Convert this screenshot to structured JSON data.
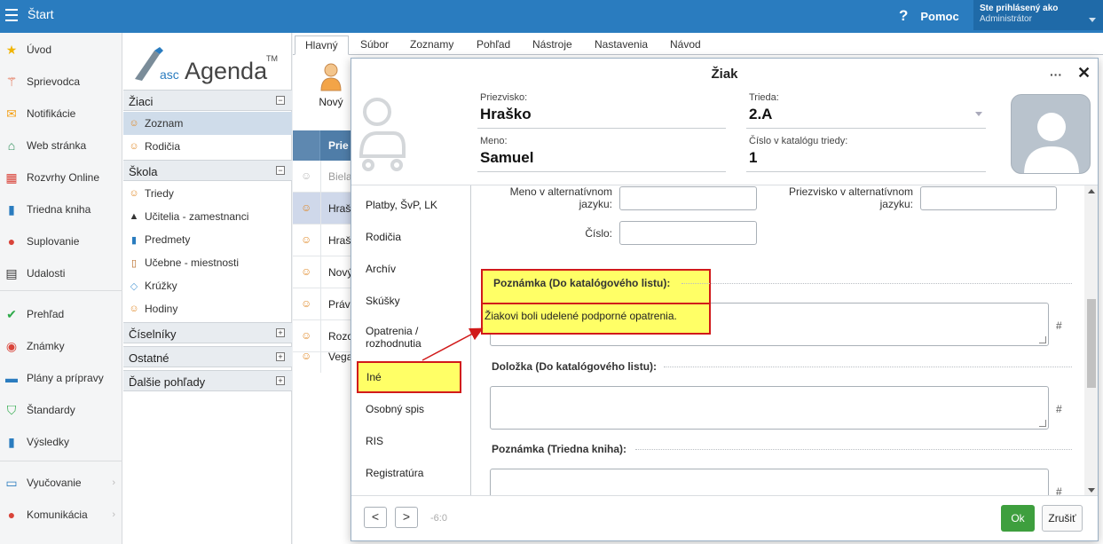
{
  "topbar": {
    "title": "Štart",
    "help": "Pomoc",
    "user_label": "Ste prihlásený ako",
    "user_name": "Administrátor"
  },
  "left_nav": [
    {
      "label": "Úvod",
      "icon": "star-icon",
      "color": "#f0b400"
    },
    {
      "label": "Sprievodca",
      "icon": "wand-icon",
      "color": "#e0502a"
    },
    {
      "label": "Notifikácie",
      "icon": "envelope-icon",
      "color": "#f3a21b"
    },
    {
      "label": "Web stránka",
      "icon": "house-icon",
      "color": "#2e8f5a"
    },
    {
      "label": "Rozvrhy Online",
      "icon": "timetable-icon",
      "color": "#d9443a"
    },
    {
      "label": "Triedna kniha",
      "icon": "book-icon",
      "color": "#2a7cbf"
    },
    {
      "label": "Suplovanie",
      "icon": "substitute-icon",
      "color": "#d9443a"
    },
    {
      "label": "Udalosti",
      "icon": "calendar-icon",
      "color": "#333333"
    },
    {
      "label": "Prehľad",
      "icon": "check-circle-icon",
      "color": "#2eaa4a"
    },
    {
      "label": "Známky",
      "icon": "grades-icon",
      "color": "#d9443a"
    },
    {
      "label": "Plány a prípravy",
      "icon": "briefcase-icon",
      "color": "#2a7cbf"
    },
    {
      "label": "Štandardy",
      "icon": "shield-check-icon",
      "color": "#2eaa4a"
    },
    {
      "label": "Výsledky",
      "icon": "bar-chart-icon",
      "color": "#2a7cbf"
    },
    {
      "label": "Vyučovanie",
      "icon": "teaching-icon",
      "color": "#2a7cbf"
    },
    {
      "label": "Komunikácia",
      "icon": "chat-icon",
      "color": "#d9443a"
    }
  ],
  "logo_text": "ascAgenda",
  "tree": {
    "zaci": {
      "label": "Žiaci",
      "items": [
        "Zoznam",
        "Rodičia"
      ]
    },
    "skola": {
      "label": "Škola",
      "items": [
        "Triedy",
        "Učitelia - zamestnanci",
        "Predmety",
        "Učebne - miestnosti",
        "Krúžky",
        "Hodiny"
      ]
    },
    "ciselniky": "Číselníky",
    "ostatne": "Ostatné",
    "dalsie": "Ďalšie pohľady"
  },
  "tabs": [
    "Hlavný",
    "Súbor",
    "Zoznamy",
    "Pohľad",
    "Nástroje",
    "Nastavenia",
    "Návod"
  ],
  "new_button": "Nový",
  "grid": {
    "header": "Prie",
    "rows": [
      "Biela",
      "Hraš",
      "Hraš",
      "Nový",
      "Práv",
      "Rozo",
      "Vega"
    ]
  },
  "dialog": {
    "title": "Žiak",
    "fields": {
      "surname_label": "Priezvisko:",
      "surname": "Hraško",
      "class_label": "Trieda:",
      "class": "2.A",
      "name_label": "Meno:",
      "name": "Samuel",
      "number_label": "Číslo v katalógu triedy:",
      "number": "1"
    },
    "nav": [
      "Platby, ŠvP, LK",
      "Rodičia",
      "Archív",
      "Skúšky",
      "Opatrenia / rozhodnutia",
      "Iné",
      "Osobný spis",
      "RIS",
      "Registratúra"
    ],
    "content": {
      "alt_name_label": "Meno v alternatívnom jazyku:",
      "alt_surname_label": "Priezvisko v alternatívnom jazyku:",
      "number_label": "Číslo:",
      "note_catalog_label": "Poznámka (Do katalógového listu):",
      "note_catalog_value": "Žiakovi boli udelené podporné opatrenia.",
      "clause_label": "Doložka (Do katalógového listu):",
      "note_class_label": "Poznámka (Triedna kniha):",
      "hash": "#"
    },
    "footer": {
      "prev": "<",
      "next": ">",
      "position": "-6:0",
      "ok": "Ok",
      "close": "Zrušiť"
    }
  }
}
